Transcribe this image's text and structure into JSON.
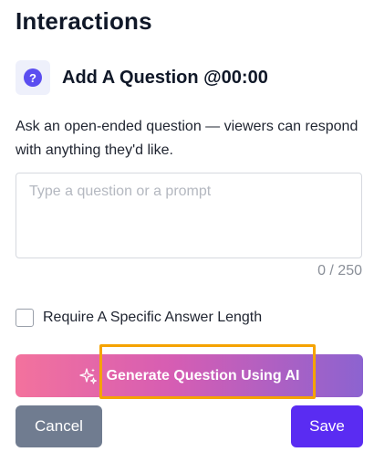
{
  "page": {
    "title": "Interactions"
  },
  "question": {
    "icon": "question-mark-icon",
    "title": "Add A Question @00:00",
    "description": "Ask an open-ended question — viewers can respond with anything they'd like.",
    "input_placeholder": "Type a question or a prompt",
    "input_value": "",
    "char_count": "0 / 250"
  },
  "options": {
    "answer_length_label": "Require A Specific Answer Length",
    "answer_length_checked": false
  },
  "actions": {
    "generate_label": "Generate Question Using AI",
    "cancel_label": "Cancel",
    "save_label": "Save"
  },
  "colors": {
    "accent": "#5a2cf2",
    "gradient_start": "#f3729d",
    "gradient_end": "#8c63d0",
    "cancel": "#707c90",
    "highlight": "#f5a300"
  }
}
